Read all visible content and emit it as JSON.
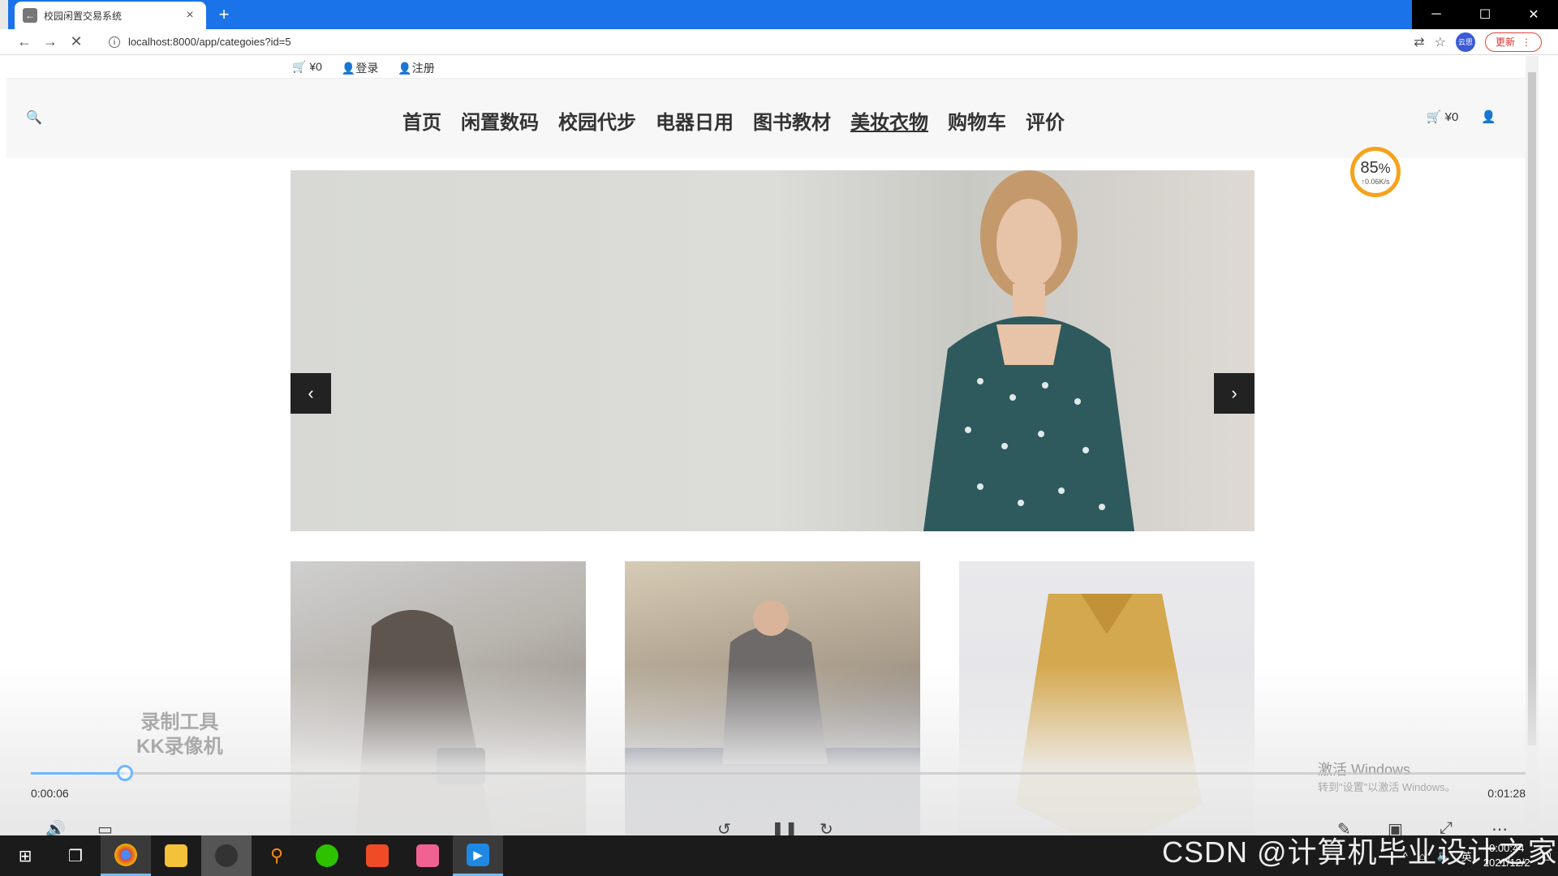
{
  "browser": {
    "tab_title": "校园闲置交易系统",
    "tab_close": "×",
    "new_tab": "+",
    "url": "localhost:8000/app/categoies?id=5",
    "update_label": "更新",
    "profile_label": "云思",
    "window_controls": {
      "minimize": "─",
      "maximize": "☐",
      "close": "✕"
    }
  },
  "site": {
    "topbar": {
      "cart": "¥0",
      "login": "登录",
      "register": "注册"
    },
    "nav": {
      "items": [
        "首页",
        "闲置数码",
        "校园代步",
        "电器日用",
        "图书教材",
        "美妆衣物",
        "购物车",
        "评价"
      ],
      "active_index": 5,
      "cart": "¥0"
    },
    "speed_widget": {
      "percent": "85",
      "unit": "%",
      "rate": "↑0.06K/s"
    }
  },
  "player": {
    "current_time": "0:00:06",
    "total_time": "0:01:28",
    "progress": 0.063,
    "watermark_line1": "录制工具",
    "watermark_line2": "KK录像机",
    "activate_title": "激活 Windows",
    "activate_sub": "转到\"设置\"以激活 Windows。"
  },
  "overlay": {
    "csdn_watermark": "CSDN @计算机毕业设计之家"
  },
  "taskbar": {
    "date": "2021/12/2",
    "time": "0:00:44",
    "ime": "英"
  },
  "colors": {
    "chrome_blue": "#1a73e8",
    "progress_blue": "#6fb6ff",
    "speed_ring": "#f7a21b",
    "update_red": "#e0463e"
  }
}
